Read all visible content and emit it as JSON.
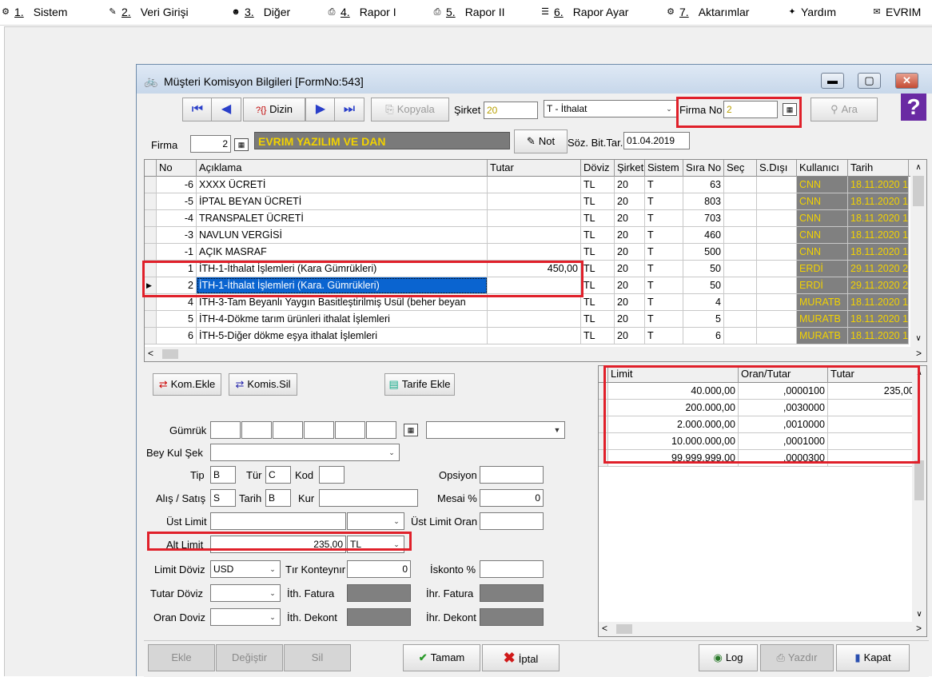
{
  "menu": [
    {
      "num": "1.",
      "label": "Sistem",
      "icon": "system-icon",
      "glyph": "⚙"
    },
    {
      "num": "2.",
      "label": "Veri Girişi",
      "icon": "data-entry-icon",
      "glyph": "✎"
    },
    {
      "num": "3.",
      "label": "Diğer",
      "icon": "people-icon",
      "glyph": "☻"
    },
    {
      "num": "4.",
      "label": "Rapor I",
      "icon": "printer-icon",
      "glyph": "⎙"
    },
    {
      "num": "5.",
      "label": "Rapor II",
      "icon": "printer-icon",
      "glyph": "⎙"
    },
    {
      "num": "6.",
      "label": "Rapor Ayar",
      "icon": "report-settings-icon",
      "glyph": "☰"
    },
    {
      "num": "7.",
      "label": "Aktarımlar",
      "icon": "transfer-icon",
      "glyph": "⚙"
    },
    {
      "num": "",
      "label": "Yardım",
      "icon": "help-icon",
      "glyph": "✦"
    },
    {
      "num": "",
      "label": "EVRIM",
      "icon": "book-icon",
      "glyph": "✉"
    }
  ],
  "window": {
    "title": "Müşteri Komisyon Bilgileri [FormNo:543]",
    "minimize": "▬",
    "maximize": "▢",
    "close": "✕"
  },
  "toolbar": {
    "first": "⏮",
    "prev": "◀",
    "dizin": "Dizin",
    "dizin_prefix": "?{}",
    "next": "▶",
    "last": "⏭",
    "kopyala": "Kopyala",
    "sirket_label": "Şirket",
    "sirket_value": "20",
    "sistem_value": "T - İthalat",
    "firma_no_label": "Firma No",
    "firma_no_value": "2",
    "ara": "Ara",
    "help": "?"
  },
  "firma": {
    "label": "Firma",
    "code": "2",
    "name": "EVRIM YAZILIM VE DAN",
    "not_button": "Not",
    "soz_label": "Söz. Bit.Tar.",
    "soz_value": "01.04.2019"
  },
  "grid": {
    "headers": [
      "No",
      "Açıklama",
      "Tutar",
      "Döviz",
      "Şirket",
      "Sistem",
      "Sıra No",
      "Seç",
      "S.Dışı",
      "Kullanıcı",
      "Tarih"
    ],
    "rows": [
      {
        "no": "-6",
        "aciklama": "XXXX ÜCRETİ",
        "tutar": "",
        "doviz": "TL",
        "sirket": "20",
        "sistem": "T",
        "sira": "63",
        "sec": "",
        "sdisi": "",
        "kullanici": "CNN",
        "tarih": "18.11.2020 1"
      },
      {
        "no": "-5",
        "aciklama": "İPTAL BEYAN ÜCRETİ",
        "tutar": "",
        "doviz": "TL",
        "sirket": "20",
        "sistem": "T",
        "sira": "803",
        "sec": "",
        "sdisi": "",
        "kullanici": "CNN",
        "tarih": "18.11.2020 1"
      },
      {
        "no": "-4",
        "aciklama": "TRANSPALET ÜCRETİ",
        "tutar": "",
        "doviz": "TL",
        "sirket": "20",
        "sistem": "T",
        "sira": "703",
        "sec": "",
        "sdisi": "",
        "kullanici": "CNN",
        "tarih": "18.11.2020 1"
      },
      {
        "no": "-3",
        "aciklama": "NAVLUN VERGİSİ",
        "tutar": "",
        "doviz": "TL",
        "sirket": "20",
        "sistem": "T",
        "sira": "460",
        "sec": "",
        "sdisi": "",
        "kullanici": "CNN",
        "tarih": "18.11.2020 1"
      },
      {
        "no": "-1",
        "aciklama": "AÇIK MASRAF",
        "tutar": "",
        "doviz": "TL",
        "sirket": "20",
        "sistem": "T",
        "sira": "500",
        "sec": "",
        "sdisi": "",
        "kullanici": "CNN",
        "tarih": "18.11.2020 1"
      },
      {
        "no": "1",
        "aciklama": "İTH-1-İthalat İşlemleri  (Kara Gümrükleri)",
        "tutar": "450,00",
        "doviz": "TL",
        "sirket": "20",
        "sistem": "T",
        "sira": "50",
        "sec": "",
        "sdisi": "",
        "kullanici": "ERDİ",
        "tarih": "29.11.2020 2"
      },
      {
        "no": "2",
        "aciklama": "İTH-1-İthalat İşlemleri  (Kara. Gümrükleri)",
        "tutar": "",
        "doviz": "TL",
        "sirket": "20",
        "sistem": "T",
        "sira": "50",
        "sec": "",
        "sdisi": "",
        "kullanici": "ERDİ",
        "tarih": "29.11.2020 2"
      },
      {
        "no": "4",
        "aciklama": "İTH-3-Tam Beyanlı Yaygın Basitleştirilmiş Usül (beher beyan",
        "tutar": "",
        "doviz": "TL",
        "sirket": "20",
        "sistem": "T",
        "sira": "4",
        "sec": "",
        "sdisi": "",
        "kullanici": "MURATB",
        "tarih": "18.11.2020 1"
      },
      {
        "no": "5",
        "aciklama": "İTH-4-Dökme tarım ürünleri ithalat İşlemleri",
        "tutar": "",
        "doviz": "TL",
        "sirket": "20",
        "sistem": "T",
        "sira": "5",
        "sec": "",
        "sdisi": "",
        "kullanici": "MURATB",
        "tarih": "18.11.2020 1"
      },
      {
        "no": "6",
        "aciklama": "İTH-5-Diğer dökme eşya ithalat İşlemleri",
        "tutar": "",
        "doviz": "TL",
        "sirket": "20",
        "sistem": "T",
        "sira": "6",
        "sec": "",
        "sdisi": "",
        "kullanici": "MURATB",
        "tarih": "18.11.2020 1"
      }
    ]
  },
  "form": {
    "kom_ekle": "Kom.Ekle",
    "komis_sil": "Komis.Sil",
    "tarife_ekle": "Tarife Ekle",
    "gumruk_label": "Gümrük",
    "bey_kul_sek_label": "Bey Kul Şek",
    "tip_label": "Tip",
    "tip_value": "B",
    "tur_label": "Tür",
    "tur_value": "C",
    "kod_label": "Kod",
    "kod_value": "",
    "opsiyon_label": "Opsiyon",
    "opsiyon_value": "",
    "alis_satis_label": "Alış / Satış",
    "alis_satis_value": "S",
    "tarih_label": "Tarih",
    "tarih_value": "B",
    "kur_label": "Kur",
    "kur_value": "",
    "mesai_label": "Mesai %",
    "mesai_value": "0",
    "ust_limit_label": "Üst Limit",
    "ust_limit_value": "",
    "ust_limit_doviz": "",
    "ust_limit_oran_label": "Üst Limit Oran",
    "ust_limit_oran_value": "",
    "alt_limit_label": "Alt Limit",
    "alt_limit_value": "235,00",
    "alt_limit_doviz": "TL",
    "limit_doviz_label": "Limit Döviz",
    "limit_doviz_value": "USD",
    "tir_konteynir_label": "Tır Konteynır",
    "tir_konteynir_value": "0",
    "iskonto_label": "İskonto %",
    "iskonto_value": "",
    "tutar_doviz_label": "Tutar Döviz",
    "tutar_doviz_value": "",
    "ith_fatura_label": "İth. Fatura",
    "ihr_fatura_label": "İhr. Fatura",
    "oran_doviz_label": "Oran Doviz",
    "oran_doviz_value": "",
    "ith_dekont_label": "İth. Dekont",
    "ihr_dekont_label": "İhr. Dekont"
  },
  "limits": {
    "headers": [
      "Limit",
      "Oran/Tutar",
      "Tutar"
    ],
    "rows": [
      {
        "limit": "40.000,00",
        "oran": ",0000100",
        "tutar": "235,00"
      },
      {
        "limit": "200.000,00",
        "oran": ",0030000",
        "tutar": ""
      },
      {
        "limit": "2.000.000,00",
        "oran": ",0010000",
        "tutar": ""
      },
      {
        "limit": "10.000.000,00",
        "oran": ",0001000",
        "tutar": ""
      },
      {
        "limit": "99.999.999,00",
        "oran": ",0000300",
        "tutar": ""
      }
    ]
  },
  "bottom": {
    "ekle": "Ekle",
    "degistir": "Değiştir",
    "sil": "Sil",
    "tamam": "Tamam",
    "iptal": "İptal",
    "log": "Log",
    "yazdir": "Yazdır",
    "kapat": "Kapat"
  },
  "colors": {
    "accent_red": "#e0202a",
    "selection": "#0a64d0",
    "user_text": "#f2d200"
  }
}
